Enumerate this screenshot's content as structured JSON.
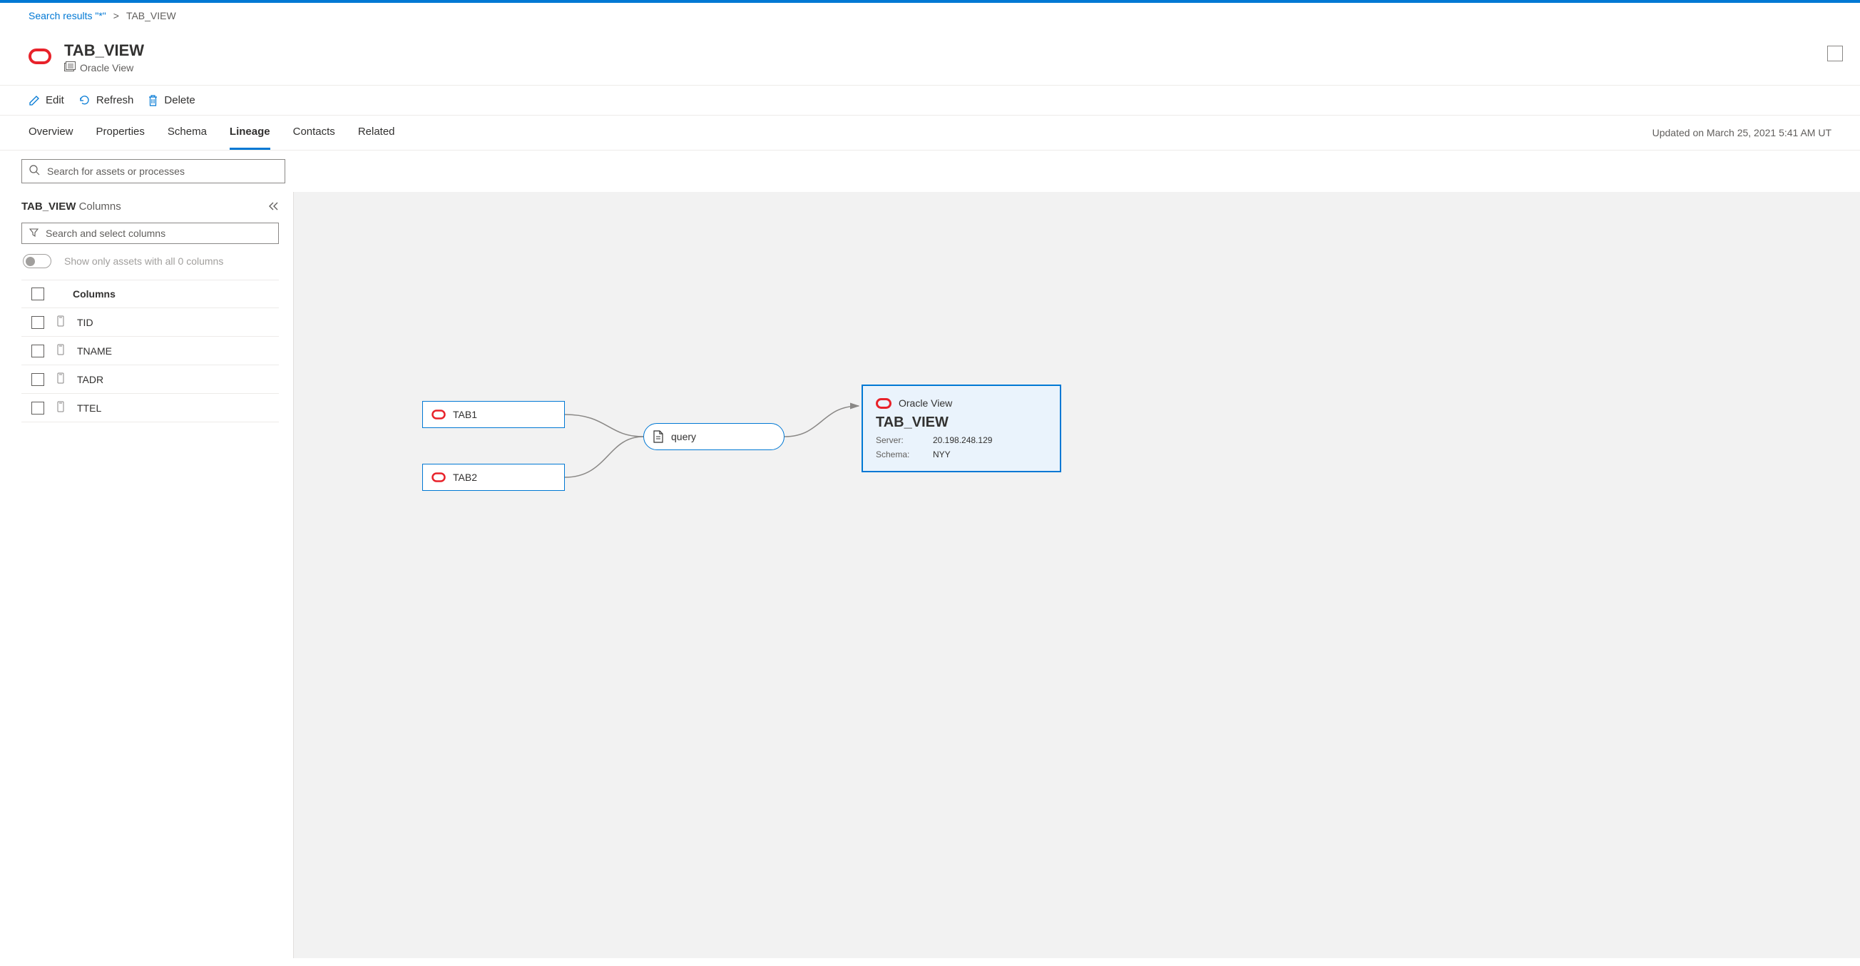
{
  "breadcrumb": {
    "link": "Search results \"*\"",
    "current": "TAB_VIEW"
  },
  "header": {
    "title": "TAB_VIEW",
    "subtitle": "Oracle View"
  },
  "toolbar": {
    "edit": "Edit",
    "refresh": "Refresh",
    "delete": "Delete"
  },
  "tabs": {
    "items": [
      "Overview",
      "Properties",
      "Schema",
      "Lineage",
      "Contacts",
      "Related"
    ],
    "active": "Lineage",
    "updated": "Updated on March 25, 2021 5:41 AM UT"
  },
  "search": {
    "placeholder": "Search for assets or processes"
  },
  "panel": {
    "title": "TAB_VIEW",
    "title_sub": "Columns",
    "filter_placeholder": "Search and select columns",
    "toggle_label": "Show only assets with all 0 columns",
    "columns_header": "Columns",
    "columns": [
      "TID",
      "TNAME",
      "TADR",
      "TTEL"
    ]
  },
  "lineage": {
    "tab1": "TAB1",
    "tab2": "TAB2",
    "query": "query",
    "detail": {
      "type": "Oracle View",
      "name": "TAB_VIEW",
      "server_label": "Server:",
      "server_value": "20.198.248.129",
      "schema_label": "Schema:",
      "schema_value": "NYY"
    }
  }
}
